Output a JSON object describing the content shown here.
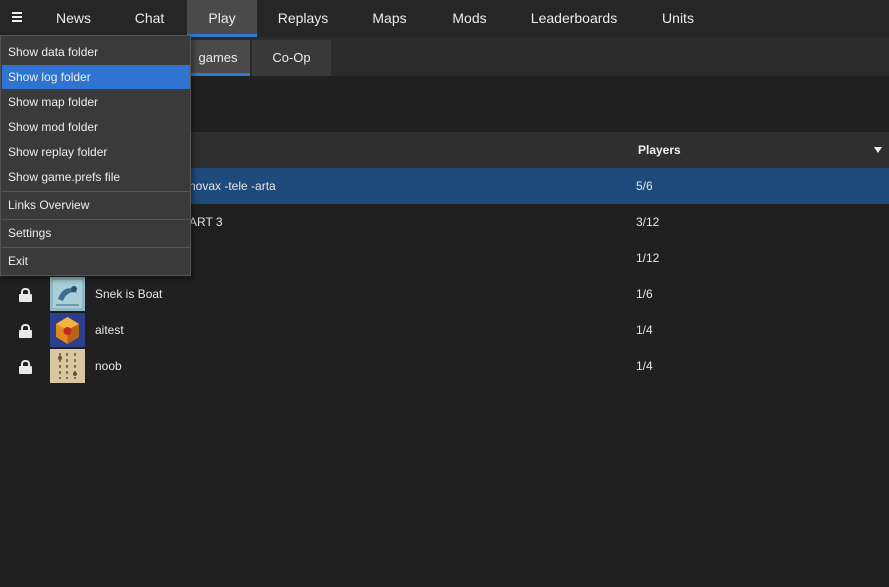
{
  "nav": {
    "menu_icon": "hamburger-menu-icon",
    "tabs": [
      {
        "label": "News"
      },
      {
        "label": "Chat"
      },
      {
        "label": "Play",
        "active": true
      },
      {
        "label": "Replays"
      },
      {
        "label": "Maps"
      },
      {
        "label": "Mods"
      },
      {
        "label": "Leaderboards"
      },
      {
        "label": "Units"
      }
    ]
  },
  "subtabs": [
    {
      "label": "games",
      "active": true
    },
    {
      "label": "Co-Op"
    }
  ],
  "table": {
    "header_players": "Players",
    "sort_icon": "sort-down-icon",
    "rows": [
      {
        "title": "novax -tele -arta",
        "players": "5/6",
        "selected": true
      },
      {
        "title": "ART 3",
        "players": "3/12"
      },
      {
        "title": "",
        "players": "1/12"
      },
      {
        "title": "Snek is Boat",
        "players": "1/6",
        "locked": true,
        "icon": "lock-icon"
      },
      {
        "title": "aitest",
        "players": "1/4",
        "locked": true,
        "icon": "lock-icon"
      },
      {
        "title": "noob",
        "players": "1/4",
        "locked": true,
        "icon": "lock-icon"
      }
    ]
  },
  "menu": {
    "items": [
      {
        "label": "Show data folder"
      },
      {
        "label": "Show log folder",
        "highlighted": true
      },
      {
        "label": "Show map folder"
      },
      {
        "label": "Show mod folder"
      },
      {
        "label": "Show replay folder"
      },
      {
        "label": "Show game.prefs file"
      },
      {
        "label": "Links Overview"
      },
      {
        "label": "Settings"
      },
      {
        "label": "Exit"
      }
    ]
  },
  "colors": {
    "accent": "#2e7ad1",
    "selected_row": "#1f4a7c",
    "menu_highlight": "#2e74d0",
    "background": "#202020"
  }
}
